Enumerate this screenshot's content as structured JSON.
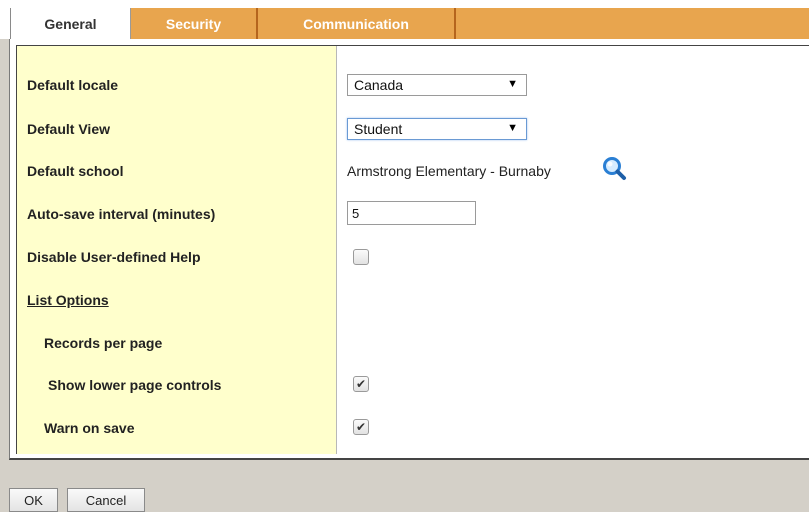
{
  "tabs": [
    {
      "label": "General",
      "active": true
    },
    {
      "label": "Security",
      "active": false
    },
    {
      "label": "Communication",
      "active": false
    }
  ],
  "form": {
    "default_locale": {
      "label": "Default locale",
      "value": "Canada"
    },
    "default_view": {
      "label": "Default View",
      "value": "Student"
    },
    "default_school": {
      "label": "Default school",
      "value": "Armstrong Elementary - Burnaby"
    },
    "auto_save": {
      "label": "Auto-save interval (minutes)",
      "value": "5"
    },
    "disable_help": {
      "label": "Disable User-defined Help",
      "checked": false
    },
    "list_options": {
      "label": "List Options"
    },
    "records_per_page": {
      "label": "Records per page"
    },
    "show_lower_controls": {
      "label": "Show lower page controls",
      "checked": true
    },
    "warn_on_save": {
      "label": "Warn on save",
      "checked": true
    }
  },
  "buttons": {
    "ok": "OK",
    "cancel": "Cancel"
  },
  "icons": {
    "dropdown_arrow": "▼",
    "check": "✔",
    "search": "search-icon"
  },
  "colors": {
    "tab_bar": "#e8a54e",
    "label_column": "#ffffcc",
    "search_icon": "#2a7fd4",
    "page_background": "#d4d0c8"
  }
}
